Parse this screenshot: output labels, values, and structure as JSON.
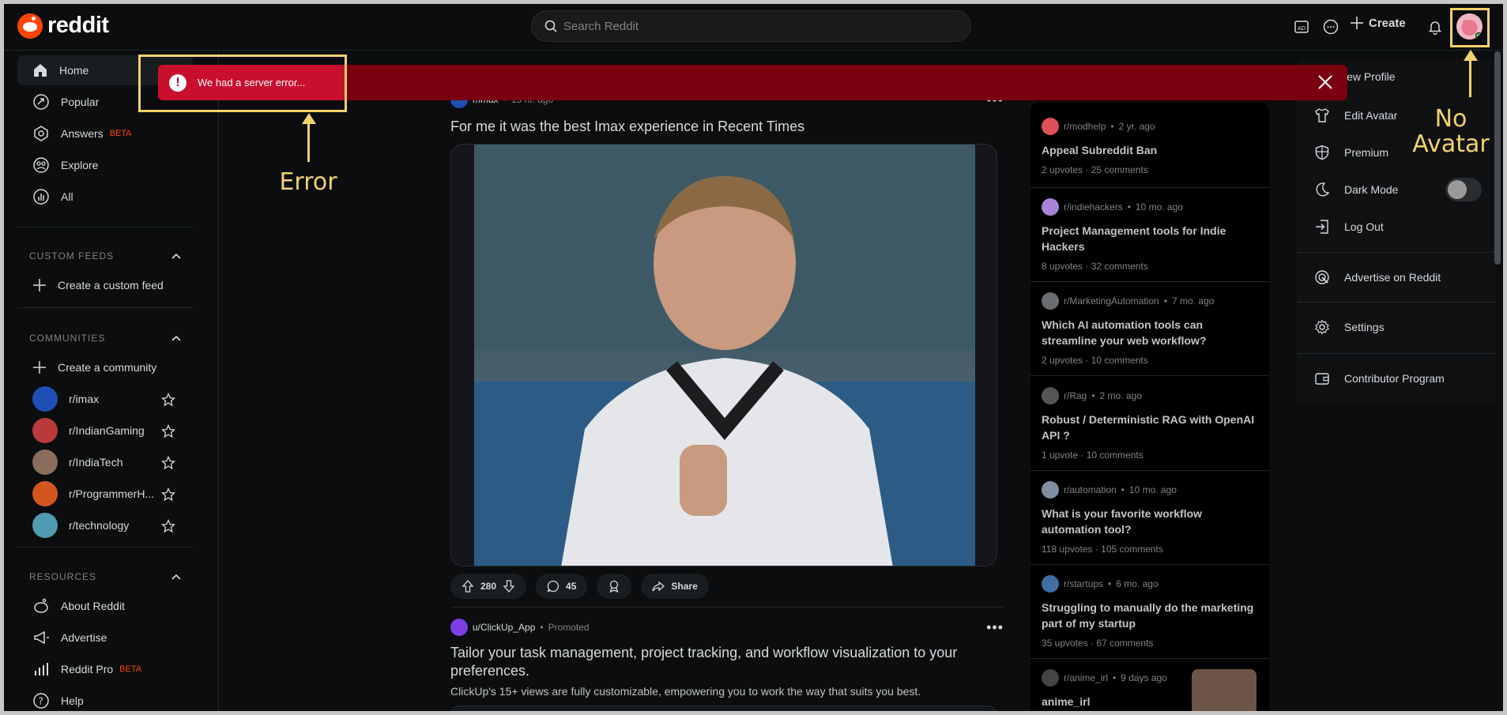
{
  "header": {
    "logo_text": "reddit",
    "search_placeholder": "Search Reddit",
    "create_label": "Create"
  },
  "sidebar": {
    "nav": [
      {
        "label": "Home"
      },
      {
        "label": "Popular"
      },
      {
        "label": "Answers",
        "badge": "BETA"
      },
      {
        "label": "Explore"
      },
      {
        "label": "All"
      }
    ],
    "custom_feeds": {
      "title": "CUSTOM FEEDS",
      "create_label": "Create a custom feed"
    },
    "communities": {
      "title": "COMMUNITIES",
      "create_label": "Create a community",
      "items": [
        "r/imax",
        "r/IndianGaming",
        "r/IndiaTech",
        "r/ProgrammerH...",
        "r/technology"
      ]
    },
    "resources": {
      "title": "RESOURCES",
      "items": [
        {
          "label": "About Reddit"
        },
        {
          "label": "Advertise"
        },
        {
          "label": "Reddit Pro",
          "badge": "BETA"
        },
        {
          "label": "Help"
        }
      ]
    }
  },
  "feed": {
    "post1": {
      "subreddit": "r/imax",
      "time": "15 hr. ago",
      "title": "For me it was the best Imax experience in Recent Times",
      "upvotes": "280",
      "comments": "45",
      "share_label": "Share"
    },
    "post2": {
      "author": "u/ClickUp_App",
      "promoted": "Promoted",
      "title": "Tailor your task management, project tracking, and workflow visualization to your preferences.",
      "body": "ClickUp's 15+ views are fully customizable, empowering you to work the way that suits you best."
    }
  },
  "right_panel": {
    "items": [
      {
        "sub": "r/modhelp",
        "time": "2 yr. ago",
        "title": "Appeal Subreddit Ban",
        "upvotes": "2 upvotes",
        "comments": "25 comments"
      },
      {
        "sub": "r/indiehackers",
        "time": "10 mo. ago",
        "title": "Project Management tools for Indie Hackers",
        "upvotes": "8 upvotes",
        "comments": "32 comments"
      },
      {
        "sub": "r/MarketingAutomation",
        "time": "7 mo. ago",
        "title": "Which AI automation tools can streamline your web workflow?",
        "upvotes": "2 upvotes",
        "comments": "10 comments"
      },
      {
        "sub": "r/Rag",
        "time": "2 mo. ago",
        "title": "Robust / Deterministic RAG with OpenAI API ?",
        "upvotes": "1 upvote",
        "comments": "10 comments"
      },
      {
        "sub": "r/automation",
        "time": "10 mo. ago",
        "title": "What is your favorite workflow automation tool?",
        "upvotes": "118 upvotes",
        "comments": "105 comments"
      },
      {
        "sub": "r/startups",
        "time": "6 mo. ago",
        "title": "Struggling to manually do the marketing part of my startup",
        "upvotes": "35 upvotes",
        "comments": "67 comments"
      },
      {
        "sub": "r/anime_irl",
        "time": "9 days ago",
        "title": "anime_irl"
      }
    ]
  },
  "menu": {
    "items": [
      {
        "label": "iew Profile"
      },
      {
        "label": "Edit Avatar"
      },
      {
        "label": "Premium"
      },
      {
        "label": "Dark Mode"
      },
      {
        "label": "Log Out"
      },
      {
        "label": "Advertise on Reddit"
      },
      {
        "label": "Settings"
      },
      {
        "label": "Contributor Program"
      }
    ]
  },
  "error": {
    "message": "We had a server error..."
  },
  "annotations": {
    "error_label": "Error",
    "avatar_label_line1": "No",
    "avatar_label_line2": "Avatar"
  },
  "colors": {
    "accent": "#ff4500",
    "error_red": "#c8102e",
    "annotation": "#f3d26b"
  }
}
